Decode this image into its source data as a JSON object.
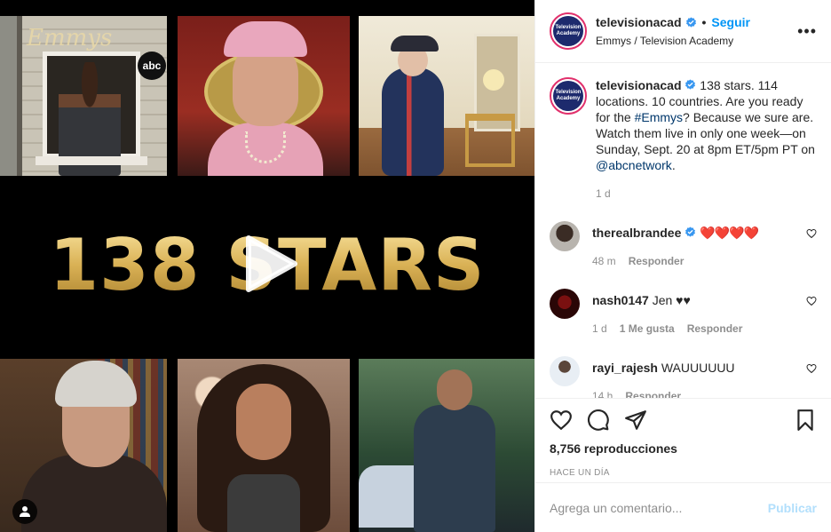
{
  "media": {
    "title_text": "138 STARS",
    "emmys_logo": "Emmys",
    "abc_logo": "abc"
  },
  "header": {
    "username": "televisionacad",
    "follow_label": "Seguir",
    "subtitle": "Emmys / Television Academy",
    "avatar_text": "Television Academy",
    "more_icon": "more-horizontal-icon"
  },
  "caption": {
    "username": "televisionacad",
    "text_1": "138 stars. 114 locations. 10 countries. Are you ready for the ",
    "hashtag": "#Emmys",
    "text_2": "? Because we sure are. Watch them live in only one week—on Sunday, Sept. 20 at 8pm ET/5pm PT on ",
    "mention": "@abcnetwork",
    "text_3": ".",
    "time": "1 d"
  },
  "comments": [
    {
      "username": "therealbrandee",
      "text": "❤️❤️❤️❤️",
      "time": "48 m",
      "likes": "",
      "reply": "Responder"
    },
    {
      "username": "nash0147",
      "text": "Jen ♥♥",
      "time": "1 d",
      "likes": "1 Me gusta",
      "reply": "Responder"
    },
    {
      "username": "rayi_rajesh",
      "text": "WAUUUUUU",
      "time": "14 h",
      "likes": "",
      "reply": "Responder"
    }
  ],
  "actions": {
    "views": "8,756 reproducciones",
    "time_ago": "HACE UN DÍA"
  },
  "add_comment": {
    "placeholder": "Agrega un comentario...",
    "publish_label": "Publicar"
  },
  "colors": {
    "link": "#00376b",
    "follow": "#0095f6",
    "publish_disabled": "#b2dffc",
    "gold": "#d9b155"
  }
}
